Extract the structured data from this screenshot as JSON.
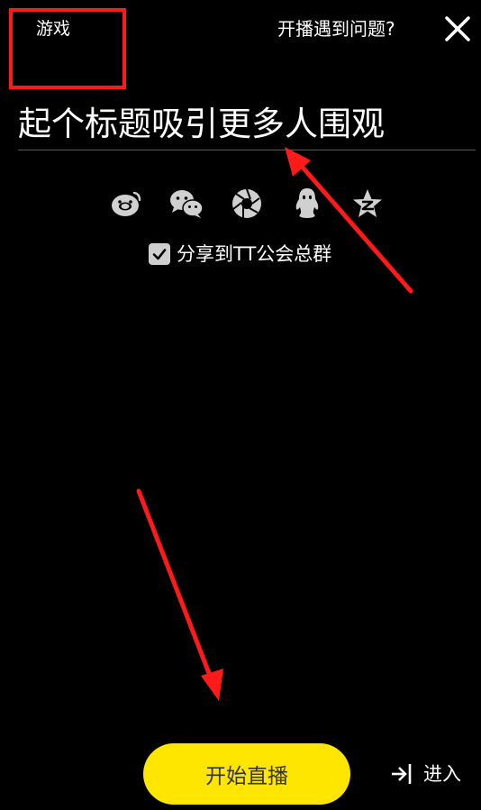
{
  "header": {
    "category_label": "游戏",
    "help_link": "开播遇到问题?",
    "close_icon": "close-icon"
  },
  "title_field": {
    "placeholder": "起个标题吸引更多人围观"
  },
  "share": {
    "platforms": [
      {
        "name": "weibo",
        "icon": "weibo-icon"
      },
      {
        "name": "wechat",
        "icon": "wechat-icon"
      },
      {
        "name": "moments",
        "icon": "moments-icon"
      },
      {
        "name": "qq",
        "icon": "qq-icon"
      },
      {
        "name": "qzone",
        "icon": "qzone-icon"
      }
    ],
    "group_checkbox_label": "分享到TT公会总群",
    "group_checkbox_checked": true
  },
  "actions": {
    "start_button": "开始直播",
    "enter_label": "进入"
  },
  "colors": {
    "background": "#000000",
    "accent": "#ffe600",
    "icon": "#d0d0d0",
    "annotation": "#ff1a1a"
  }
}
